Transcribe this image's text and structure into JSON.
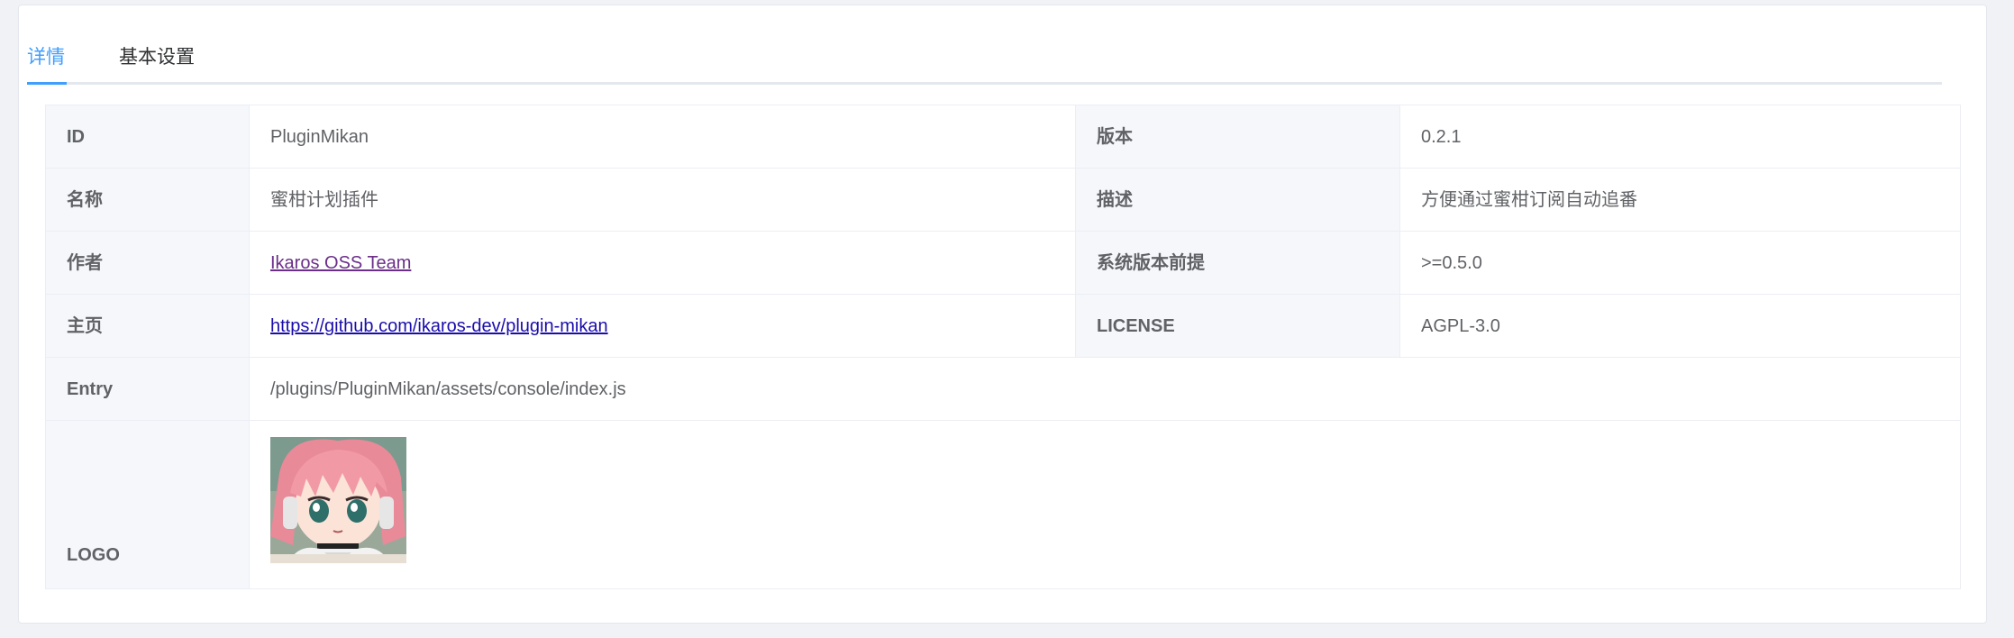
{
  "tabs": [
    {
      "label": "详情",
      "active": true
    },
    {
      "label": "基本设置",
      "active": false
    }
  ],
  "details": {
    "id": {
      "label": "ID",
      "value": "PluginMikan"
    },
    "version": {
      "label": "版本",
      "value": "0.2.1"
    },
    "name": {
      "label": "名称",
      "value": "蜜柑计划插件"
    },
    "description": {
      "label": "描述",
      "value": "方便通过蜜柑订阅自动追番"
    },
    "author": {
      "label": "作者",
      "value": "Ikaros OSS Team"
    },
    "system_version": {
      "label": "系统版本前提",
      "value": ">=0.5.0"
    },
    "homepage": {
      "label": "主页",
      "value": "https://github.com/ikaros-dev/plugin-mikan"
    },
    "license": {
      "label": "LICENSE",
      "value": "AGPL-3.0"
    },
    "entry": {
      "label": "Entry",
      "value": "/plugins/PluginMikan/assets/console/index.js"
    },
    "logo": {
      "label": "LOGO",
      "image": "anime-girl-avatar"
    }
  },
  "colors": {
    "accent": "#409eff",
    "label_bg": "#f5f7fa",
    "border": "#ebeef5",
    "visited_link": "#6b2f8a",
    "link": "#1a0dab"
  }
}
